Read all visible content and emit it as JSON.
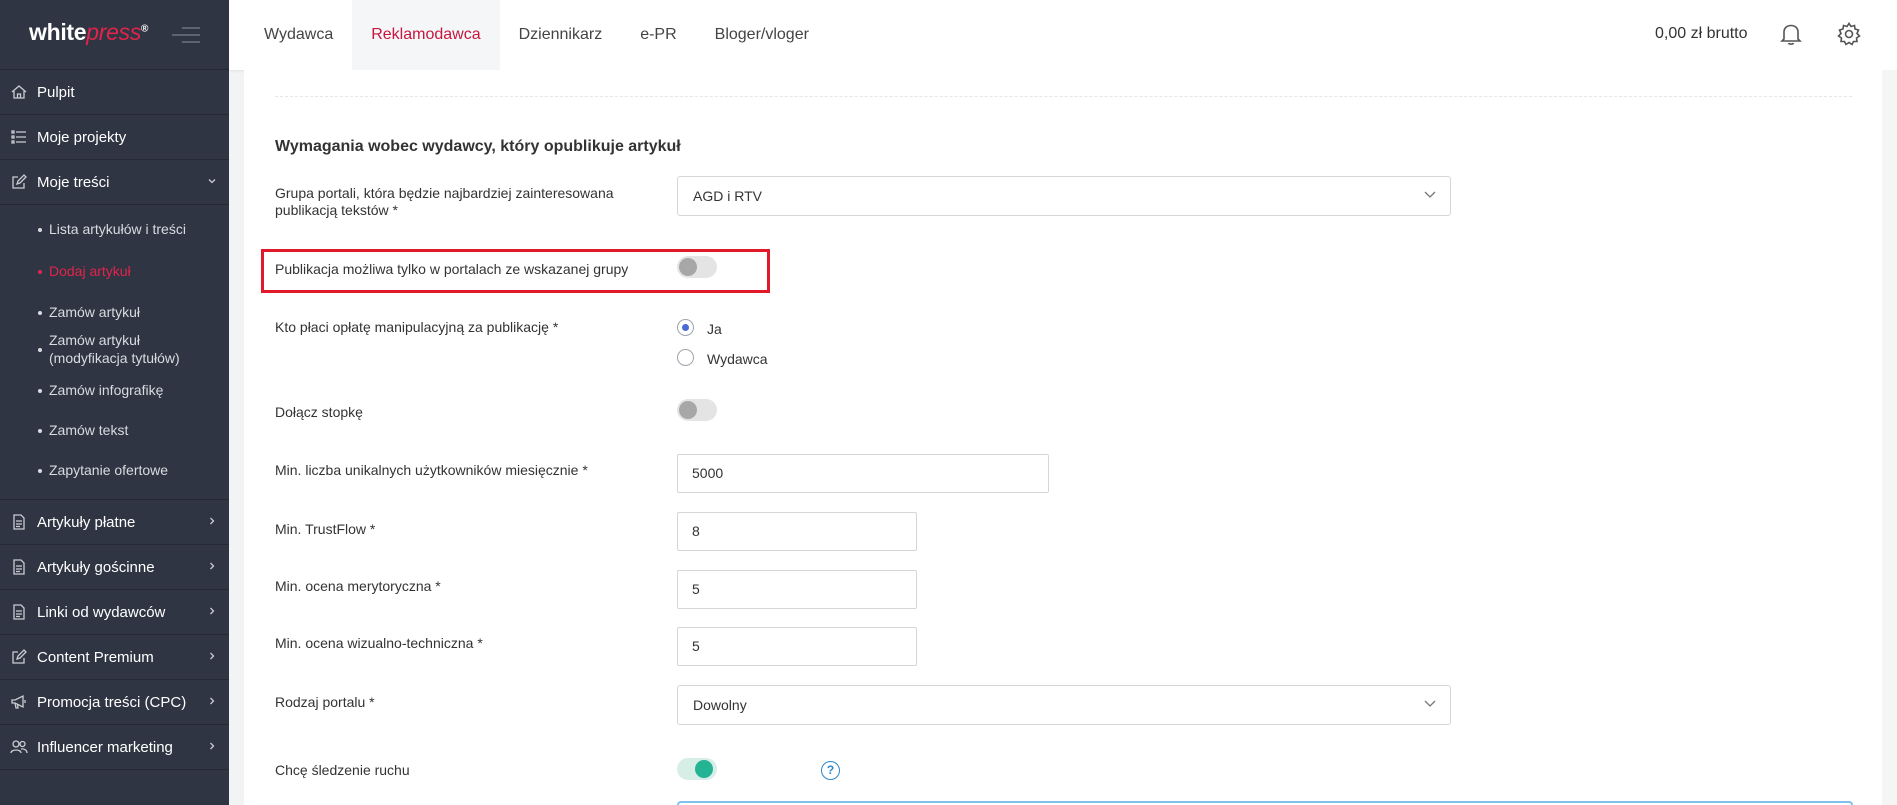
{
  "sidebar": {
    "logo": {
      "white": "white",
      "press": "press",
      "mark": "®"
    },
    "items": [
      {
        "label": "Pulpit",
        "icon": "home-icon"
      },
      {
        "label": "Moje projekty",
        "icon": "list-icon"
      },
      {
        "label": "Moje treści",
        "icon": "edit-icon",
        "expanded": true
      }
    ],
    "submenu": [
      {
        "label": "Lista artykułów i treści"
      },
      {
        "label": "Dodaj artykuł",
        "active": true
      },
      {
        "label": "Zamów artykuł"
      },
      {
        "label_line1": "Zamów artykuł",
        "label_line2": "(modyfikacja tytułów)"
      },
      {
        "label": "Zamów infografikę"
      },
      {
        "label": "Zamów tekst"
      },
      {
        "label": "Zapytanie ofertowe"
      }
    ],
    "items_after": [
      {
        "label": "Artykuły płatne",
        "icon": "document-icon"
      },
      {
        "label": "Artykuły gościnne",
        "icon": "document-icon"
      },
      {
        "label": "Linki od wydawców",
        "icon": "document-icon"
      },
      {
        "label": "Content Premium",
        "icon": "edit-icon"
      },
      {
        "label": "Promocja treści (CPC)",
        "icon": "megaphone-icon"
      },
      {
        "label": "Influencer marketing",
        "icon": "users-icon"
      }
    ]
  },
  "topbar": {
    "tabs": [
      {
        "label": "Wydawca"
      },
      {
        "label": "Reklamodawca",
        "active": true
      },
      {
        "label": "Dziennikarz"
      },
      {
        "label": "e-PR"
      },
      {
        "label": "Bloger/vloger"
      }
    ],
    "balance": "0,00 zł brutto"
  },
  "form": {
    "section_title": "Wymagania wobec wydawcy, który opublikuje artykuł",
    "portal_group": {
      "label_line1": "Grupa portali, która będzie najbardziej zainteresowana",
      "label_line2": "publikacją tekstów *",
      "value": "AGD i RTV"
    },
    "only_group": {
      "label": "Publikacja możliwa tylko w portalach ze wskazanej grupy",
      "on": false
    },
    "fee_payer": {
      "label": "Kto płaci opłatę manipulacyjną za publikację *",
      "options": [
        {
          "label": "Ja",
          "checked": true
        },
        {
          "label": "Wydawca",
          "checked": false
        }
      ]
    },
    "footer": {
      "label": "Dołącz stopkę",
      "on": false
    },
    "min_users": {
      "label": "Min. liczba unikalnych użytkowników miesięcznie *",
      "value": "5000"
    },
    "min_trustflow": {
      "label": "Min. TrustFlow *",
      "value": "8"
    },
    "min_merit": {
      "label": "Min. ocena merytoryczna *",
      "value": "5"
    },
    "min_visual": {
      "label": "Min. ocena wizualno-techniczna *",
      "value": "5"
    },
    "portal_type": {
      "label": "Rodzaj portalu *",
      "value": "Dowolny"
    },
    "tracking": {
      "label": "Chcę śledzenie ruchu",
      "on": true,
      "help": "?"
    }
  },
  "colors": {
    "accent": "#e2244c",
    "sidebar": "#2f3542",
    "toggle_on": "#24b494",
    "highlight": "#e01a2b"
  }
}
